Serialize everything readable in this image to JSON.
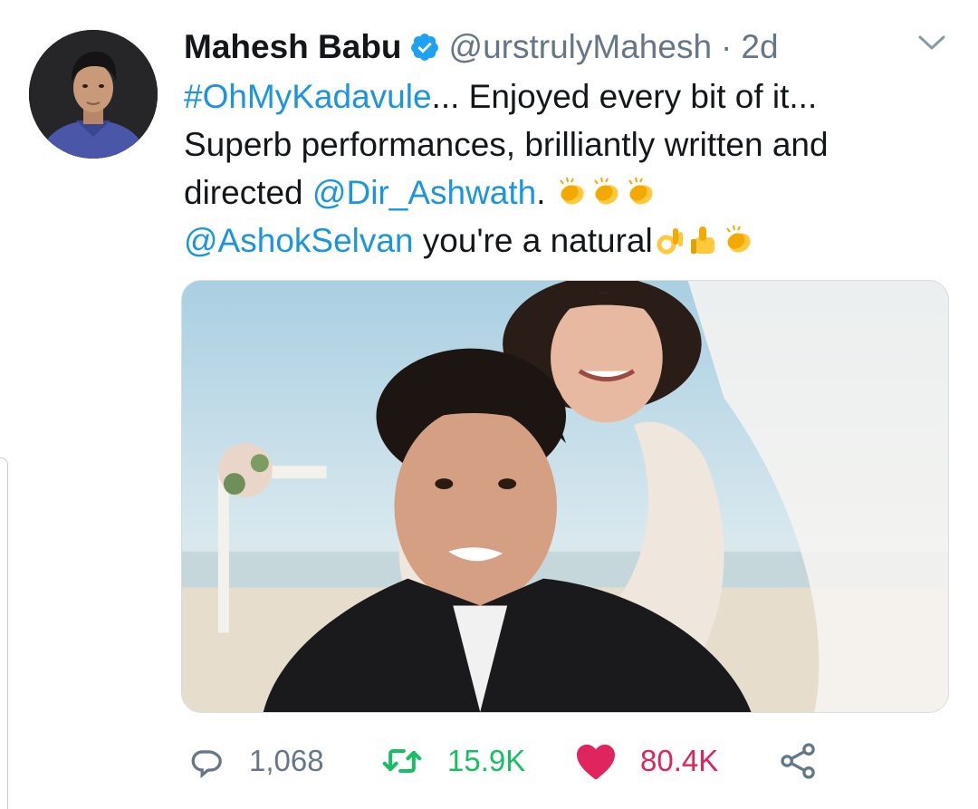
{
  "tweet": {
    "display_name": "Mahesh Babu",
    "handle": "@urstrulyMahesh",
    "separator": "·",
    "time": "2d",
    "verified": true,
    "body": {
      "hashtag": "#OhMyKadavule",
      "line1_rest": "... Enjoyed every bit of it...",
      "line2": "Superb performances, brilliantly written and",
      "line3_prefix": "directed ",
      "mention1": "@Dir_Ashwath",
      "line3_suffix": ".",
      "mention2": "@AshokSelvan",
      "line4_rest": " you're a natural"
    },
    "emojis": [
      "clapping-hands",
      "clapping-hands",
      "clapping-hands",
      "ok-hand",
      "thumbs-up",
      "clapping-hands"
    ],
    "actions": {
      "reply_count": "1,068",
      "retweet_count": "15.9K",
      "like_count": "80.4K"
    }
  },
  "colors": {
    "link": "#1b95e0",
    "muted": "#657786",
    "retweet": "#17bf63",
    "like": "#e0245e",
    "verified": "#1da1f2"
  },
  "icons": {
    "verified": "verified-badge-icon",
    "menu": "chevron-down-icon",
    "reply": "reply-icon",
    "retweet": "retweet-icon",
    "like": "heart-icon",
    "share": "share-icon"
  }
}
